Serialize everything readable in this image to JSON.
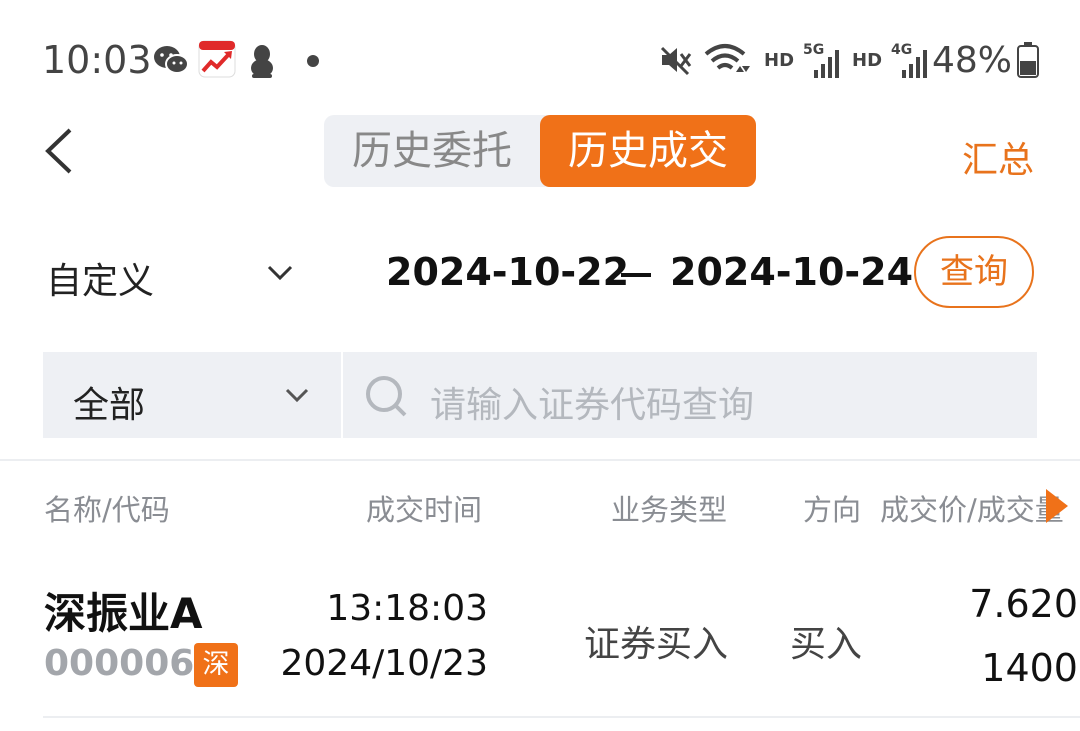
{
  "status_bar": {
    "time": "10:03",
    "battery": "48%",
    "hd1": "HD",
    "net1": "5G",
    "hd2": "HD",
    "net2": "4G",
    "icons": [
      "wechat-icon",
      "tencent-stock-icon",
      "qq-icon",
      "dot-icon",
      "mute-icon",
      "wifi-icon",
      "signal-icon",
      "battery-icon"
    ]
  },
  "header": {
    "tabs": [
      {
        "label": "历史委托",
        "active": false
      },
      {
        "label": "历史成交",
        "active": true
      }
    ],
    "summary_label": "汇总"
  },
  "date_filter": {
    "range_type": "自定义",
    "date_from": "2024-10-22",
    "date_to": "2024-10-24",
    "query_label": "查询"
  },
  "filter": {
    "market": "全部",
    "search_placeholder": "请输入证券代码查询"
  },
  "table": {
    "columns": [
      "名称/代码",
      "成交时间",
      "业务类型",
      "方向",
      "成交价/成交量"
    ],
    "rows": [
      {
        "name": "深振业A",
        "code": "000006",
        "exchange": "深",
        "time": "13:18:03",
        "date": "2024/10/23",
        "biz_type": "证券买入",
        "direction": "买入",
        "price": "7.620",
        "qty": "1400"
      }
    ]
  },
  "colors": {
    "accent": "#f07118",
    "accent_text": "#e8731c",
    "segment_bg": "#eef0f4",
    "muted_text": "#8a8d93"
  }
}
